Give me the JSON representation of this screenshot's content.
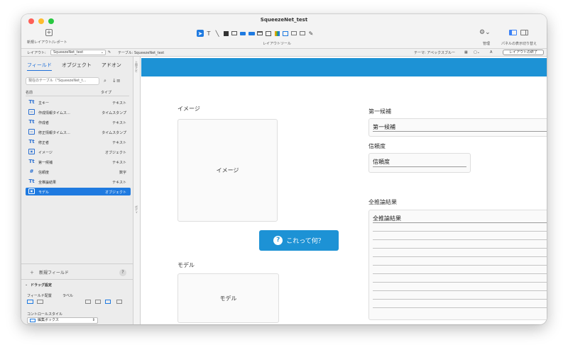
{
  "window": {
    "title": "SqueezeNet_test"
  },
  "toolbar": {
    "new_layout_label": "新規レイアウト/レポート",
    "layout_tools_label": "レイアウトツール",
    "manage_label": "管理",
    "panel_toggle_label": "パネルの表示切り替え"
  },
  "layoutbar": {
    "layout_label": "レイアウト:",
    "layout_value": "SqueezeNet_test",
    "table_text": "テーブル: SqueezeNet_test",
    "theme_text": "テーマ: アペックスブルー",
    "exit_label": "レイアウトの終了"
  },
  "sidebar": {
    "tabs": [
      "フィールド",
      "オブジェクト",
      "アドオン"
    ],
    "table_select": "現在のテーブル（\"SqueezeNet_t...",
    "col_name": "名前",
    "col_type": "タイプ",
    "fields": [
      {
        "icon": "Tt",
        "name": "主キー",
        "type": "テキスト"
      },
      {
        "icon": "▭",
        "name": "作成情報タイムス…",
        "type": "タイムスタンプ"
      },
      {
        "icon": "Tt",
        "name": "作成者",
        "type": "テキスト"
      },
      {
        "icon": "▭",
        "name": "修正情報タイムス…",
        "type": "タイムスタンプ"
      },
      {
        "icon": "Tt",
        "name": "修正者",
        "type": "テキスト"
      },
      {
        "icon": "▣",
        "name": "イメージ",
        "type": "オブジェクト"
      },
      {
        "icon": "Tt",
        "name": "第一候補",
        "type": "テキスト"
      },
      {
        "icon": "#",
        "name": "信頼度",
        "type": "数字"
      },
      {
        "icon": "Tt",
        "name": "全推論結果",
        "type": "テキスト"
      },
      {
        "icon": "▣",
        "name": "モデル",
        "type": "オブジェクト"
      }
    ],
    "new_field_label": "新規フィールド",
    "help_label": "?",
    "drag_settings_label": "ドラッグ設定",
    "field_placement_label": "フィールド配置",
    "label_label": "ラベル",
    "control_style_label": "コントロールスタイル",
    "control_style_value": "編集ボックス",
    "strip_top": "上部ナビ",
    "strip_mid": "ボディ"
  },
  "canvas": {
    "image_label": "イメージ",
    "image_box_text": "イメージ",
    "what_button": "これって何？",
    "model_label": "モデル",
    "model_box_text": "モデル",
    "first_label": "第一候補",
    "first_field": "第一候補",
    "confidence_label": "信頼度",
    "confidence_field": "信頼度",
    "all_label": "全推論結果",
    "all_field": "全推論結果"
  },
  "colors": {
    "accent": "#1d92d5",
    "selection": "#1f7ae0"
  }
}
